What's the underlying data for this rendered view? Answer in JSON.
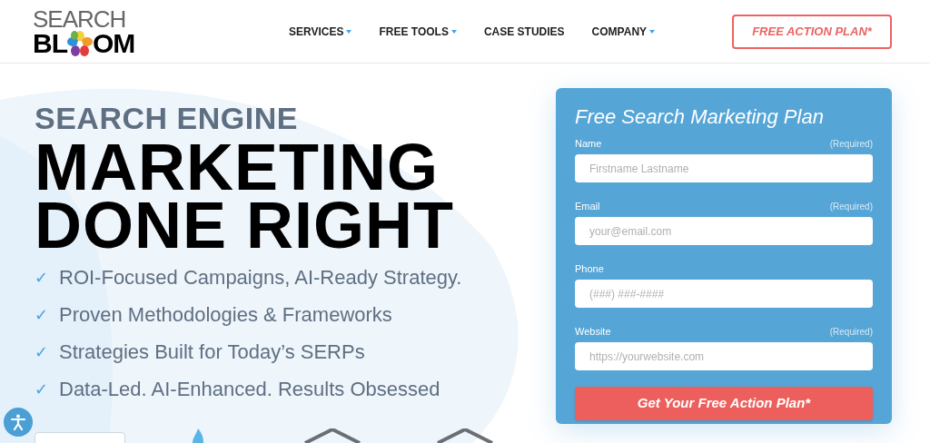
{
  "logo": {
    "top": "SEARCH",
    "left": "BL",
    "right": "OM"
  },
  "nav": [
    {
      "label": "SERVICES",
      "dropdown": true
    },
    {
      "label": "FREE TOOLS",
      "dropdown": true
    },
    {
      "label": "CASE STUDIES",
      "dropdown": false
    },
    {
      "label": "COMPANY",
      "dropdown": true
    }
  ],
  "header_button": "FREE ACTION PLAN*",
  "hero": {
    "eyebrow": "SEARCH ENGINE",
    "headline": [
      "MARKETING",
      "DONE RIGHT"
    ],
    "bullets": [
      {
        "mark": "✓",
        "text": "ROI-Focused Campaigns, AI-Ready Strategy."
      },
      {
        "mark": "✓",
        "text": "Proven Methodologies & Frameworks"
      },
      {
        "mark": "✓",
        "text": "Strategies Built for Today’s SERPs"
      },
      {
        "mark": "✓",
        "text": "Data-Led. AI-Enhanced. Results Obsessed"
      }
    ]
  },
  "form": {
    "title": "Free Search Marketing Plan",
    "fields": [
      {
        "label": "Name",
        "required": "(Required)",
        "placeholder": "Firstname Lastname"
      },
      {
        "label": "Email",
        "required": "(Required)",
        "placeholder": "your@email.com"
      },
      {
        "label": "Phone",
        "placeholder": "(###) ###-####"
      },
      {
        "label": "Website",
        "required": "(Required)",
        "placeholder": "https://yourwebsite.com"
      }
    ],
    "submit": "Get Your Free Action Plan*"
  }
}
